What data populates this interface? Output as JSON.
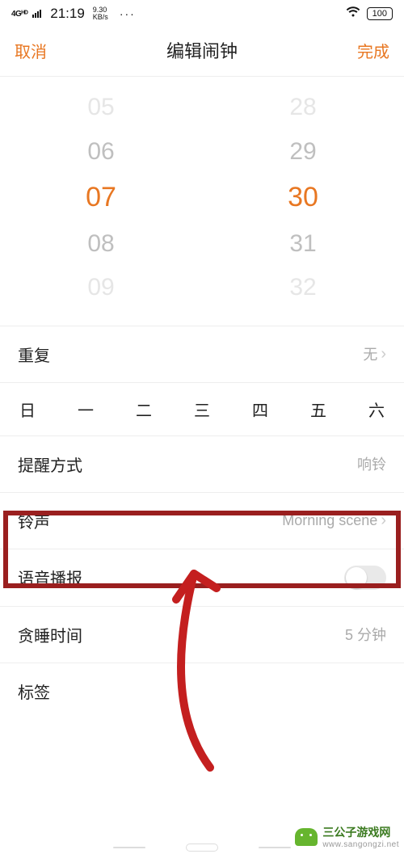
{
  "status": {
    "network_label": "4Gᴴᴰ",
    "time": "21:19",
    "speed_top": "9.30",
    "speed_bottom": "KB/s",
    "battery": "100"
  },
  "nav": {
    "cancel": "取消",
    "title": "编辑闹钟",
    "done": "完成"
  },
  "picker": {
    "hours": [
      "05",
      "06",
      "07",
      "08",
      "09"
    ],
    "minutes": [
      "28",
      "29",
      "30",
      "31",
      "32"
    ],
    "selected_hour": "07",
    "selected_minute": "30"
  },
  "rows": {
    "repeat": {
      "label": "重复",
      "value": "无"
    },
    "reminder": {
      "label": "提醒方式",
      "value": "响铃"
    },
    "ringtone": {
      "label": "铃声",
      "value": "Morning scene"
    },
    "voice": {
      "label": "语音播报"
    },
    "snooze": {
      "label": "贪睡时间",
      "value": "5 分钟"
    },
    "tag": {
      "label": "标签"
    }
  },
  "weekdays": [
    "日",
    "一",
    "二",
    "三",
    "四",
    "五",
    "六"
  ],
  "watermark": {
    "title": "三公子游戏网",
    "url": "www.sangongzi.net"
  }
}
